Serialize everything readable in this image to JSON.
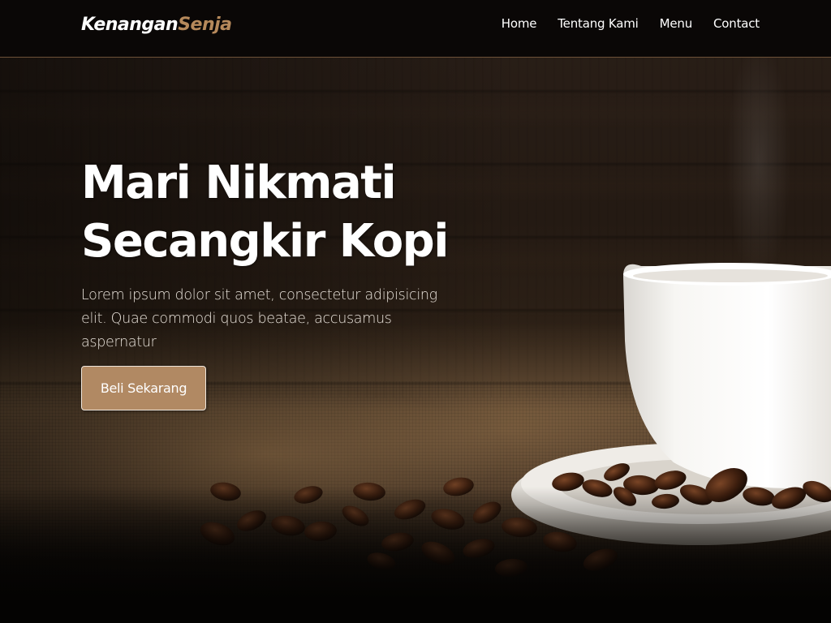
{
  "brand": {
    "part1": "Kenangan",
    "part2": "Senja"
  },
  "nav": {
    "items": [
      {
        "label": "Home"
      },
      {
        "label": "Tentang Kami"
      },
      {
        "label": "Menu"
      },
      {
        "label": "Contact"
      }
    ]
  },
  "hero": {
    "title_line1": "Mari Nikmati",
    "title_line2": "Secangkir Kopi",
    "description": "Lorem ipsum dolor sit amet, consectetur adipisicing elit. Quae commodi quos beatae, accusamus aspernatur",
    "cta_label": "Beli Sekarang"
  },
  "colors": {
    "accent": "#b6895b",
    "button_bg": "#b18963",
    "navbar_border": "#6d5138",
    "text": "#ffffff"
  }
}
